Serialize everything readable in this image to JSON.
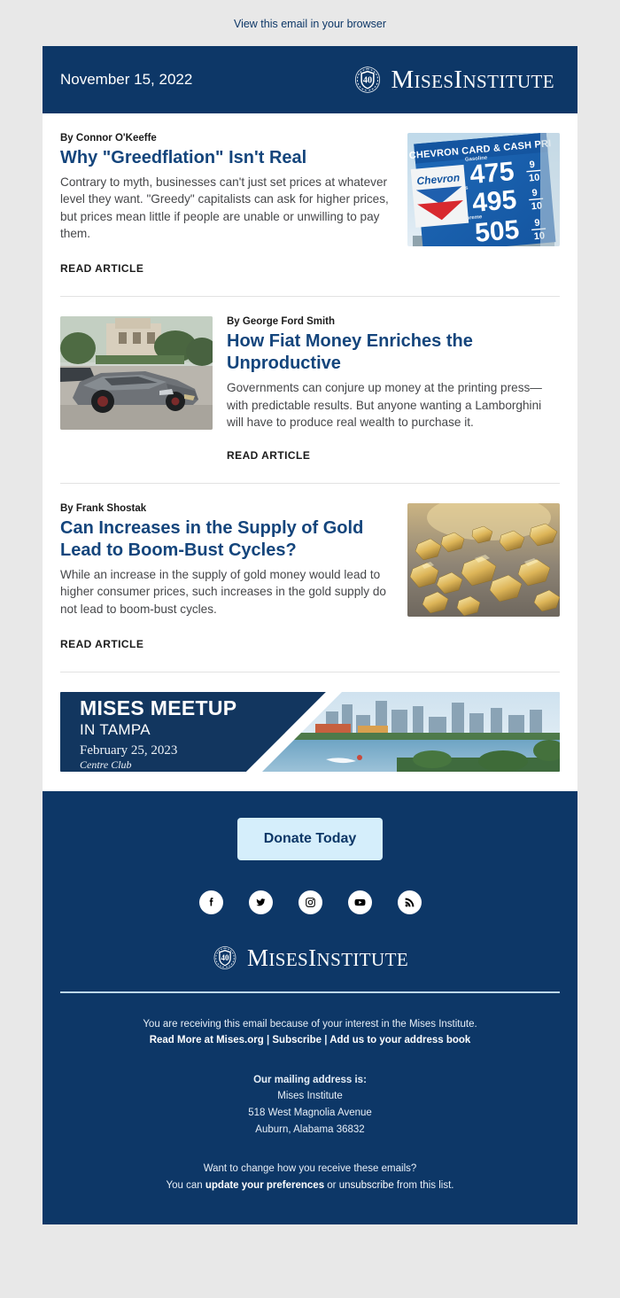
{
  "preheader": {
    "link_text": "View this email in your browser"
  },
  "header": {
    "date": "November 15, 2022",
    "logo_badge": "40",
    "logo_word1_cap": "M",
    "logo_word1_rest": "ISES",
    "logo_word2_cap": "I",
    "logo_word2_rest": "NSTITUTE"
  },
  "colors": {
    "navy": "#0d3767",
    "headline_blue": "#14457c",
    "page_bg": "#e8e8e8",
    "donate_bg": "#d5eefb",
    "divider": "#e2e2e2",
    "footer_rule": "#bcd7ea"
  },
  "articles": [
    {
      "byline": "By Connor O'Keeffe",
      "headline": "Why \"Greedflation\" Isn't Real",
      "dek": "Contrary to myth, businesses can't just set prices at whatever level they want. \"Greedy\" capitalists can ask for higher prices, but prices mean little if people are unable or unwilling to pay them.",
      "cta": "READ ARTICLE",
      "image_alt": "chevron-gas-price-sign",
      "image_text": {
        "sign_header": "CHEVRON CARD & CASH PRICES",
        "brand": "Chevron",
        "rows": [
          {
            "grade": "Gasoline",
            "price": "475",
            "fraction_top": "9",
            "fraction_bottom": "10"
          },
          {
            "grade": "Plus",
            "price": "495",
            "fraction_top": "9",
            "fraction_bottom": "10"
          },
          {
            "grade": "Supreme",
            "price": "505",
            "fraction_top": "9",
            "fraction_bottom": "10"
          }
        ]
      }
    },
    {
      "byline": "By George Ford Smith",
      "headline": "How Fiat Money Enriches the Unproductive",
      "dek": "Governments can conjure up money at the printing press—with predictable results. But anyone wanting a Lamborghini will have to produce real wealth to purchase it.",
      "cta": "READ ARTICLE",
      "image_alt": "grey-lamborghini-in-front-of-mansion"
    },
    {
      "byline": "By Frank Shostak",
      "headline": "Can Increases in the Supply of Gold Lead to Boom-Bust Cycles?",
      "dek": "While an increase in the supply of gold money would lead to higher consumer prices, such increases in the gold supply do not lead to boom-bust cycles.",
      "cta": "READ ARTICLE",
      "image_alt": "gold-nuggets-on-grey-surface"
    }
  ],
  "event_banner": {
    "title": "MISES MEETUP",
    "subtitle": "IN TAMPA",
    "date": "February 25, 2023",
    "venue": "Centre Club",
    "image_alt": "tampa-waterfront-skyline"
  },
  "footer": {
    "donate_label": "Donate Today",
    "socials": [
      {
        "name": "facebook",
        "label": "Facebook"
      },
      {
        "name": "twitter",
        "label": "Twitter"
      },
      {
        "name": "instagram",
        "label": "Instagram"
      },
      {
        "name": "youtube",
        "label": "YouTube"
      },
      {
        "name": "rss",
        "label": "RSS"
      }
    ],
    "interest_line": "You are receiving this email because of your interest in the Mises Institute.",
    "links_line": {
      "read_more": "Read More at Mises.org",
      "sep1": " | ",
      "subscribe": "Subscribe",
      "sep2": " | ",
      "address_book": "Add us to your address book"
    },
    "mailing_heading": "Our mailing address is:",
    "mailing_org": "Mises Institute",
    "mailing_street": "518 West Magnolia Avenue",
    "mailing_city": "Auburn, Alabama 36832",
    "prefs_question": "Want to change how you receive these emails?",
    "prefs_prefix": "You can ",
    "prefs_link": "update your preferences",
    "prefs_mid": " or ",
    "prefs_link2": "unsubscribe",
    "prefs_suffix": " from this list."
  }
}
